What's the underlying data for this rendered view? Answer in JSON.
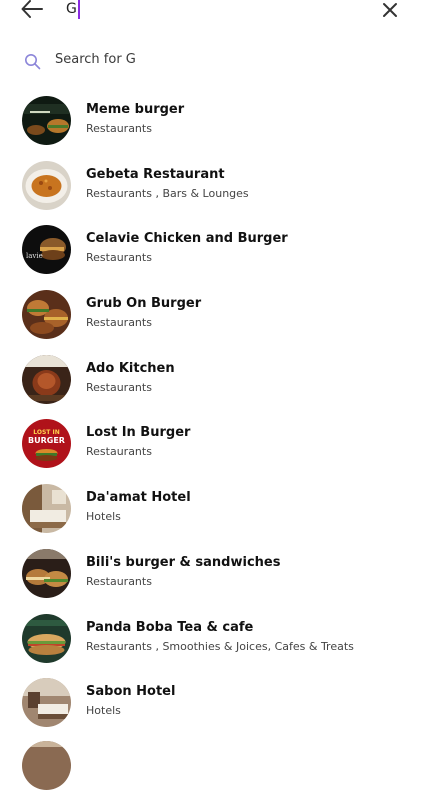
{
  "search": {
    "query": "G",
    "suggestion": "Search for G"
  },
  "icons": {
    "back": "arrow-left-icon",
    "close": "close-icon",
    "search": "search-icon"
  },
  "colors": {
    "caret": "#8a2be2",
    "search_icon": "#8c86d9"
  },
  "results": [
    {
      "title": "Meme burger",
      "subtitle": "Restaurants"
    },
    {
      "title": "Gebeta Restaurant",
      "subtitle": "Restaurants , Bars & Lounges"
    },
    {
      "title": "Celavie Chicken and Burger",
      "subtitle": "Restaurants"
    },
    {
      "title": "Grub On Burger",
      "subtitle": "Restaurants"
    },
    {
      "title": "Ado Kitchen",
      "subtitle": "Restaurants"
    },
    {
      "title": "Lost In Burger",
      "subtitle": "Restaurants"
    },
    {
      "title": "Da'amat Hotel",
      "subtitle": "Hotels"
    },
    {
      "title": "Bili's burger & sandwiches",
      "subtitle": "Restaurants"
    },
    {
      "title": "Panda Boba Tea & cafe",
      "subtitle": "Restaurants , Smoothies & Joices, Cafes & Treats"
    },
    {
      "title": "Sabon Hotel",
      "subtitle": "Hotels"
    }
  ]
}
